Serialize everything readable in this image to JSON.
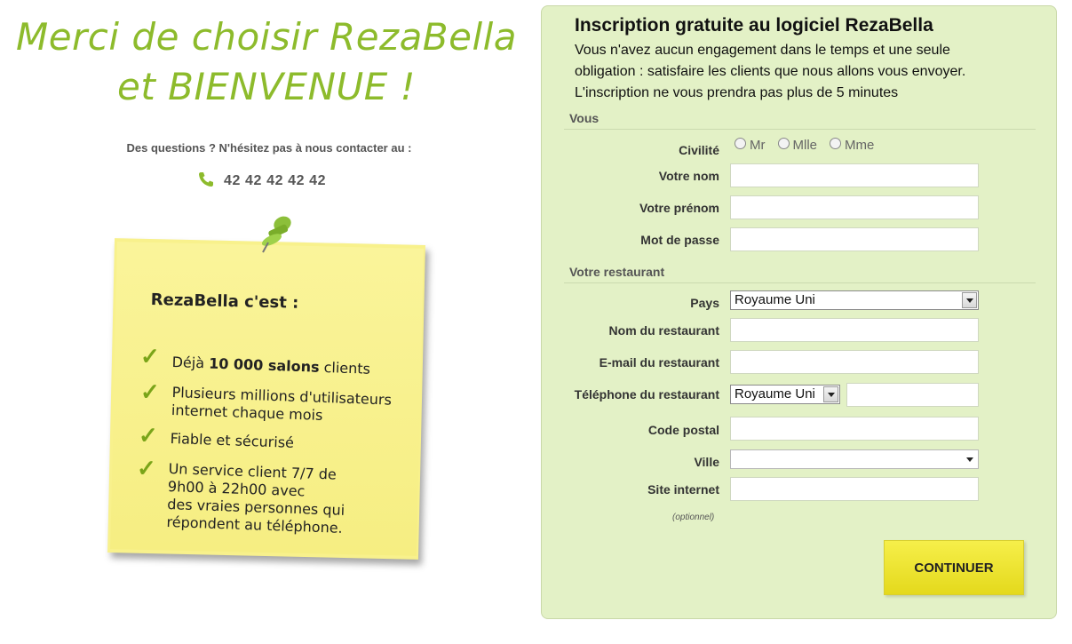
{
  "left": {
    "welcome_line1": "Merci de choisir RezaBella",
    "welcome_line2": "et BIENVENUE !",
    "contact_text": "Des questions ? N'hésitez pas à nous contacter au :",
    "phone_icon": "phone-icon",
    "phone_number": "42 42 42 42 42",
    "note": {
      "title": "RezaBella c'est :",
      "items": [
        {
          "pre": "Déjà ",
          "bold": "10 000 salons",
          "post": " clients"
        },
        {
          "line1": "Plusieurs millions d'utilisateurs",
          "line2": "internet chaque mois"
        },
        {
          "text": "Fiable et sécurisé"
        },
        {
          "line1": "Un service client 7/7 de",
          "line2": "9h00 à 22h00 avec",
          "line3": "des vraies personnes qui",
          "line4": "répondent au téléphone."
        }
      ]
    }
  },
  "form": {
    "title": "Inscription gratuite au logiciel RezaBella",
    "desc_line1": "Vous n'avez aucun engagement dans le temps et une seule",
    "desc_line2": "obligation : satisfaire les clients que nous allons vous envoyer.",
    "desc_line3": "L'inscription ne vous prendra pas plus de 5 minutes",
    "section_vous": "Vous",
    "civilite_label": "Civilité",
    "civilite_options": [
      "Mr",
      "Mlle",
      "Mme"
    ],
    "nom_label": "Votre nom",
    "prenom_label": "Votre prénom",
    "password_label": "Mot de passe",
    "section_restaurant": "Votre restaurant",
    "pays_label": "Pays",
    "pays_value": "Royaume Uni",
    "resto_name_label": "Nom du restaurant",
    "resto_email_label": "E-mail du restaurant",
    "resto_phone_label": "Téléphone du restaurant",
    "phone_country_value": "Royaume Uni",
    "postal_label": "Code postal",
    "ville_label": "Ville",
    "ville_value": "",
    "site_label": "Site internet",
    "optional_text": "(optionnel)",
    "submit_label": "CONTINUER"
  },
  "colors": {
    "accent_green": "#8dbb2c",
    "panel_bg": "#e3f1c6",
    "note_yellow": "#f8f18c",
    "button_yellow": "#f0e633"
  }
}
